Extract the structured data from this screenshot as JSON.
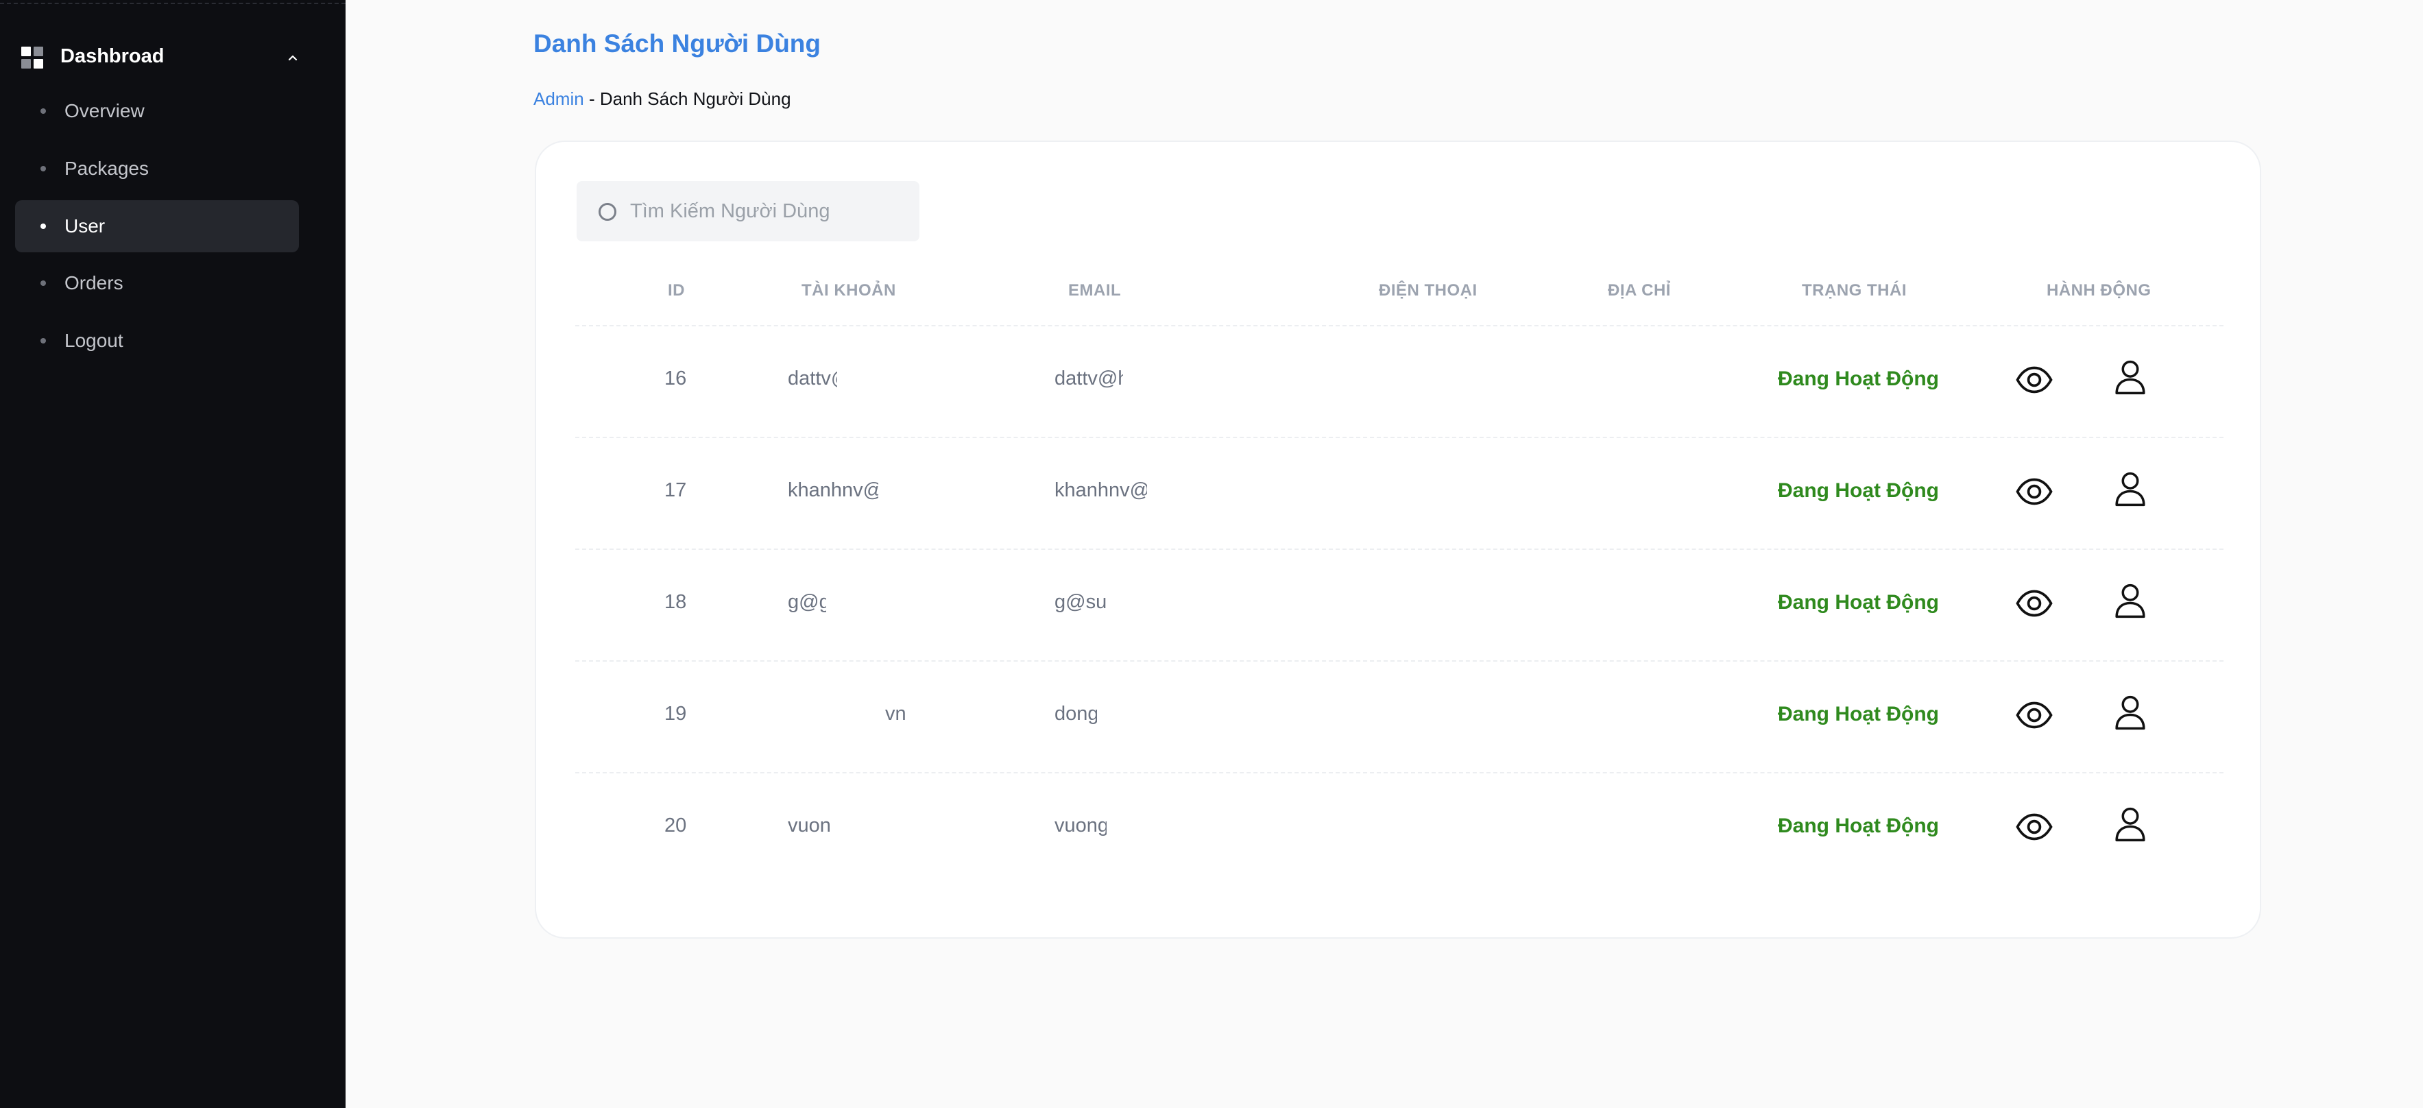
{
  "sidebar": {
    "title": "Dashbroad",
    "items": [
      {
        "label": "Overview",
        "active": false
      },
      {
        "label": "Packages",
        "active": false
      },
      {
        "label": "User",
        "active": true
      },
      {
        "label": "Orders",
        "active": false
      },
      {
        "label": "Logout",
        "active": false
      }
    ]
  },
  "page": {
    "title": "Danh Sách Người Dùng",
    "breadcrumb": {
      "link": "Admin",
      "separator": "-",
      "current": "Danh Sách Người Dùng"
    }
  },
  "search": {
    "placeholder": "Tìm Kiếm Người Dùng",
    "icon": "search-icon"
  },
  "table": {
    "columns": [
      "ID",
      "TÀI KHOẢN",
      "EMAIL",
      "ĐIỆN THOẠI",
      "ĐỊA CHỈ",
      "TRẠNG THÁI",
      "HÀNH ĐỘNG"
    ],
    "rows": [
      {
        "id": "16",
        "account": "dattv@",
        "email": "dattv@h",
        "phone": "",
        "address": "",
        "status": "Đang Hoạt Động"
      },
      {
        "id": "17",
        "account": "khanhnv@",
        "email": "khanhnv@",
        "phone": "",
        "address": "",
        "status": "Đang Hoạt Động"
      },
      {
        "id": "18",
        "account": "g@g",
        "email": "g@su",
        "phone": "",
        "address": "",
        "status": "Đang Hoạt Động"
      },
      {
        "id": "19",
        "account": "vn",
        "email": "dong",
        "phone": "",
        "address": "",
        "status": "Đang Hoạt Động"
      },
      {
        "id": "20",
        "account": "vuon",
        "email": "vuong",
        "phone": "",
        "address": "",
        "status": "Đang Hoạt Động"
      }
    ],
    "action_icons": [
      "eye-icon",
      "user-icon"
    ]
  },
  "colors": {
    "sidebar_bg": "#0d0e12",
    "accent": "#3b82e0",
    "status_active": "#2f8a1e",
    "header_text": "#9ca3af"
  }
}
